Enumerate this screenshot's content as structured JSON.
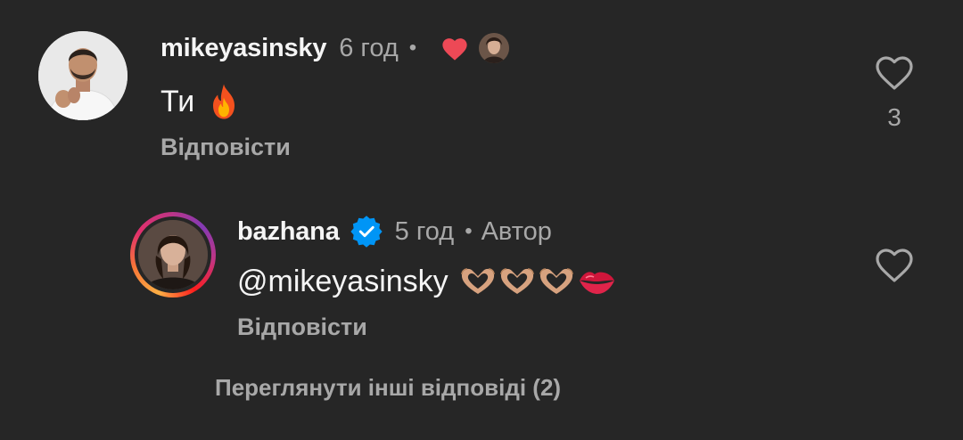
{
  "comment": {
    "username": "mikeyasinsky",
    "time": "6 год",
    "separator": "•",
    "text": "Ти",
    "reply_label": "Відповісти",
    "like_count": "3",
    "icons": [
      "red-heart-icon",
      "author-liked-avatar",
      "fire-emoji",
      "heart-outline-icon"
    ]
  },
  "reply": {
    "username": "bazhana",
    "time": "5 год",
    "separator": "•",
    "author_label": "Автор",
    "text": "@mikeyasinsky",
    "reply_label": "Відповісти",
    "icons": [
      "verified-badge-icon",
      "heart-hands-emoji",
      "kiss-mark-emoji",
      "heart-outline-icon"
    ]
  },
  "view_more": {
    "label": "Переглянути інші відповіді (2)"
  },
  "colors": {
    "background": "#262626",
    "primary_text": "#f5f5f5",
    "secondary_text": "#a8a8a8",
    "like_red": "#ed4956",
    "verified_blue": "#0095f6"
  }
}
